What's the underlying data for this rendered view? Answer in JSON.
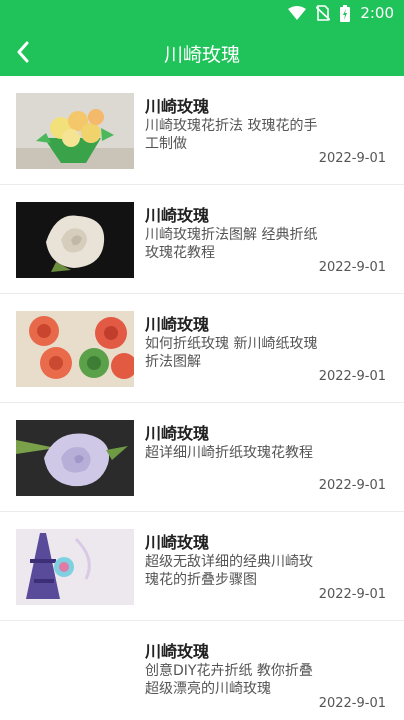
{
  "status_bar": {
    "time": "2:00",
    "icons": [
      "wifi-icon",
      "no-sim-icon",
      "battery-icon"
    ]
  },
  "header": {
    "title": "川崎玫瑰",
    "back_icon": "back-arrow-icon"
  },
  "colors": {
    "accent": "#1fc35a"
  },
  "items": [
    {
      "title": "川崎玫瑰",
      "desc": "川崎玫瑰花折法 玫瑰花的手工制做",
      "date": "2022-9-01",
      "image": "yellow-roses-bouquet"
    },
    {
      "title": "川崎玫瑰",
      "desc": "川崎玫瑰折法图解 经典折纸玫瑰花教程",
      "date": "2022-9-01",
      "image": "white-paper-rose"
    },
    {
      "title": "川崎玫瑰",
      "desc": "如何折纸玫瑰 新川崎纸玫瑰折法图解",
      "date": "2022-9-01",
      "image": "red-green-paper-roses"
    },
    {
      "title": "川崎玫瑰",
      "desc": "超详细川崎折纸玫瑰花教程",
      "date": "2022-9-01",
      "image": "lavender-paper-rose"
    },
    {
      "title": "川崎玫瑰",
      "desc": "超级无敌详细的经典川崎玫瑰花的折叠步骤图",
      "date": "2022-9-01",
      "image": "purple-tower-rose"
    },
    {
      "title": "川崎玫瑰",
      "desc": "创意DIY花卉折纸 教你折叠超级漂亮的川崎玫瑰",
      "date": "2022-9-01",
      "image": "none"
    }
  ]
}
